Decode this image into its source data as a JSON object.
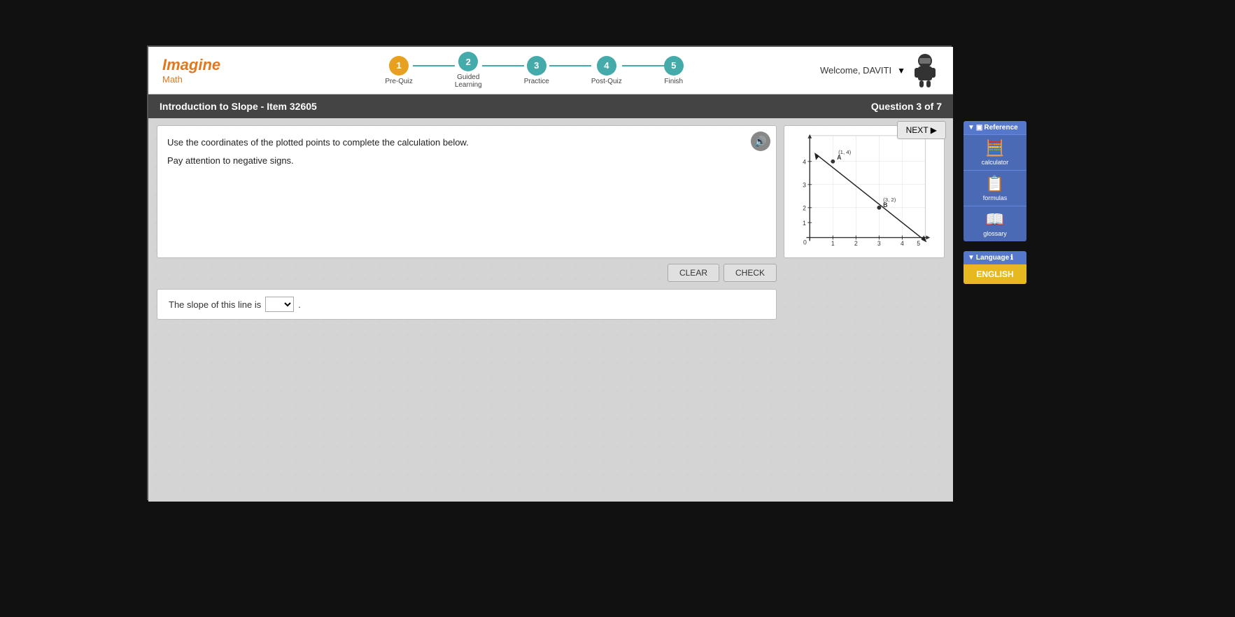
{
  "app": {
    "logo": "Imagine",
    "logo_sub": "Math",
    "welcome": "Welcome, DAVITI",
    "welcome_dropdown": "▼"
  },
  "progress": {
    "steps": [
      {
        "number": "1",
        "label": "Pre-Quiz",
        "state": "active"
      },
      {
        "number": "2",
        "label": "Guided\nLearning",
        "state": "future"
      },
      {
        "number": "3",
        "label": "Practice",
        "state": "future"
      },
      {
        "number": "4",
        "label": "Post-Quiz",
        "state": "future"
      },
      {
        "number": "5",
        "label": "Finish",
        "state": "future"
      }
    ]
  },
  "titleBar": {
    "title": "Introduction to Slope - Item 32605",
    "question_counter": "Question 3 of 7"
  },
  "question": {
    "instruction_line1": "Use the coordinates of the plotted points to complete the calculation below.",
    "instruction_line2": "Pay attention to negative signs."
  },
  "graph": {
    "point_a": "(1, 4)",
    "point_b": "(3, 2)",
    "label_a": "A",
    "label_b": "B"
  },
  "buttons": {
    "next": "NEXT ▶",
    "clear": "CLEAR",
    "check": "CHECK"
  },
  "slope_answer": {
    "prefix": "The slope of this line is",
    "suffix": "."
  },
  "reference": {
    "header": "▼ ▣Reference",
    "items": [
      {
        "icon": "🧮",
        "label": "calculator"
      },
      {
        "icon": "📋",
        "label": "formulas"
      },
      {
        "icon": "📖",
        "label": "glossary"
      }
    ]
  },
  "language": {
    "header": "▼ Language ℹ",
    "button": "ENGLISH"
  }
}
